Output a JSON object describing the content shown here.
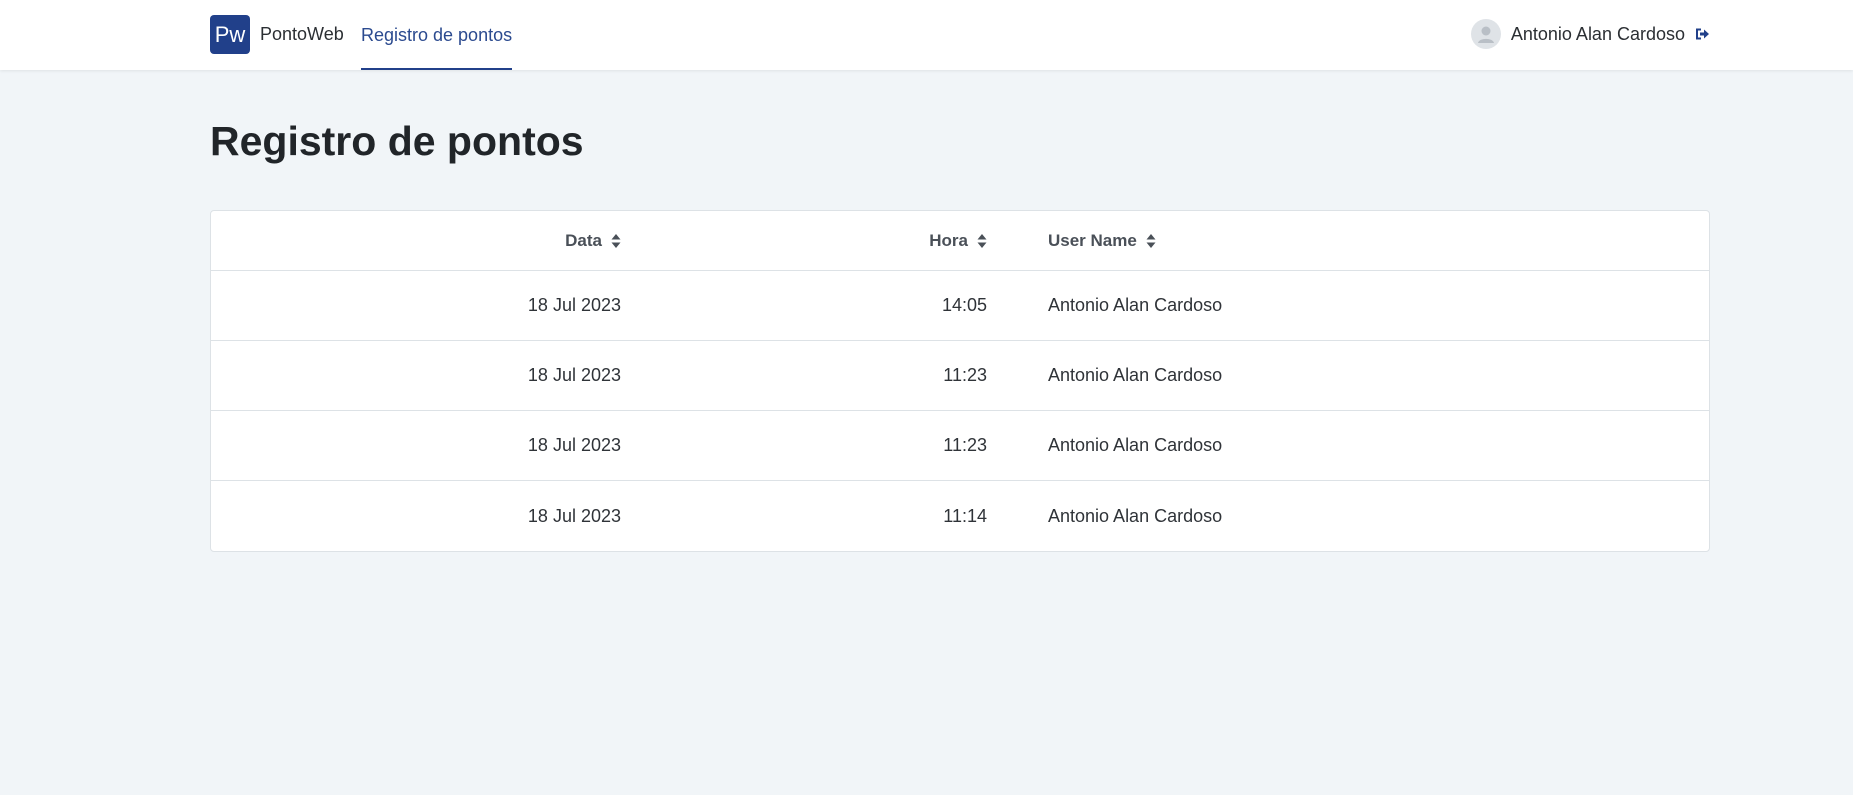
{
  "navbar": {
    "logo_text": "Pw",
    "brand_name": "PontoWeb",
    "nav_link": "Registro de pontos",
    "user_name": "Antonio Alan Cardoso",
    "accent_color": "#21408a"
  },
  "page": {
    "title": "Registro de pontos"
  },
  "table": {
    "columns": [
      "Data",
      "Hora",
      "User Name"
    ],
    "rows": [
      [
        "18 Jul 2023",
        "14:05",
        "Antonio Alan Cardoso"
      ],
      [
        "18 Jul 2023",
        "11:23",
        "Antonio Alan Cardoso"
      ],
      [
        "18 Jul 2023",
        "11:23",
        "Antonio Alan Cardoso"
      ],
      [
        "18 Jul 2023",
        "11:14",
        "Antonio Alan Cardoso"
      ]
    ]
  },
  "icons": {
    "avatar": "user-avatar-icon",
    "logout": "logout-icon",
    "sort": "sort-icon"
  }
}
